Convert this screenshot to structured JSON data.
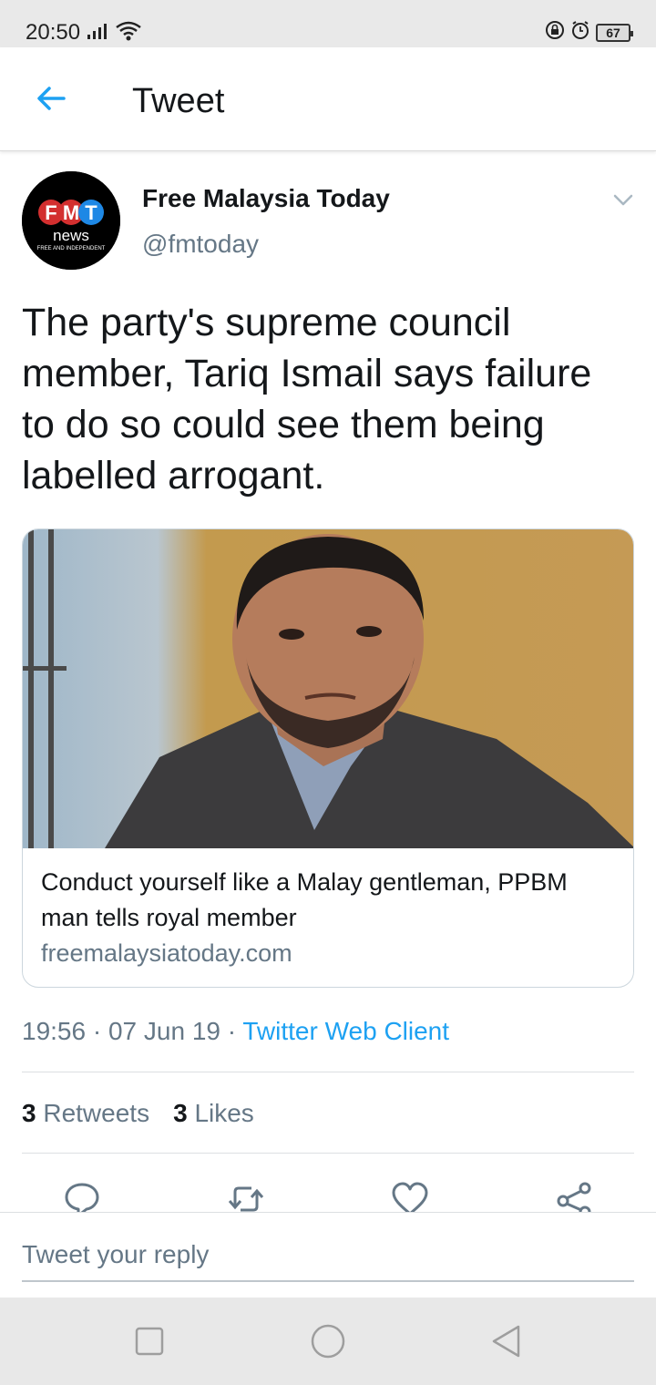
{
  "status_bar": {
    "time": "20:50",
    "battery": "67"
  },
  "header": {
    "title": "Tweet"
  },
  "tweet": {
    "author_name": "Free Malaysia Today",
    "author_handle": "@fmtoday",
    "avatar_logo": {
      "letters": [
        "F",
        "M",
        "T"
      ],
      "word": "news",
      "tagline": "FREE AND INDEPENDENT"
    },
    "text": "The party's supreme council member, Tariq Ismail says failure to do so could see them being labelled arrogant.",
    "card": {
      "title": "Conduct yourself like a Malay gentleman, PPBM man tells royal member",
      "domain": "freemalaysiatoday.com"
    },
    "time": "19:56",
    "date": "07 Jun 19",
    "client": "Twitter Web Client",
    "retweets_count": "3",
    "retweets_label": "Retweets",
    "likes_count": "3",
    "likes_label": "Likes"
  },
  "reply": {
    "placeholder": "Tweet your reply"
  },
  "colors": {
    "accent": "#1da1f2",
    "secondary_text": "#657786",
    "logo_red": "#d32f2f",
    "logo_blue": "#1e88e5"
  }
}
